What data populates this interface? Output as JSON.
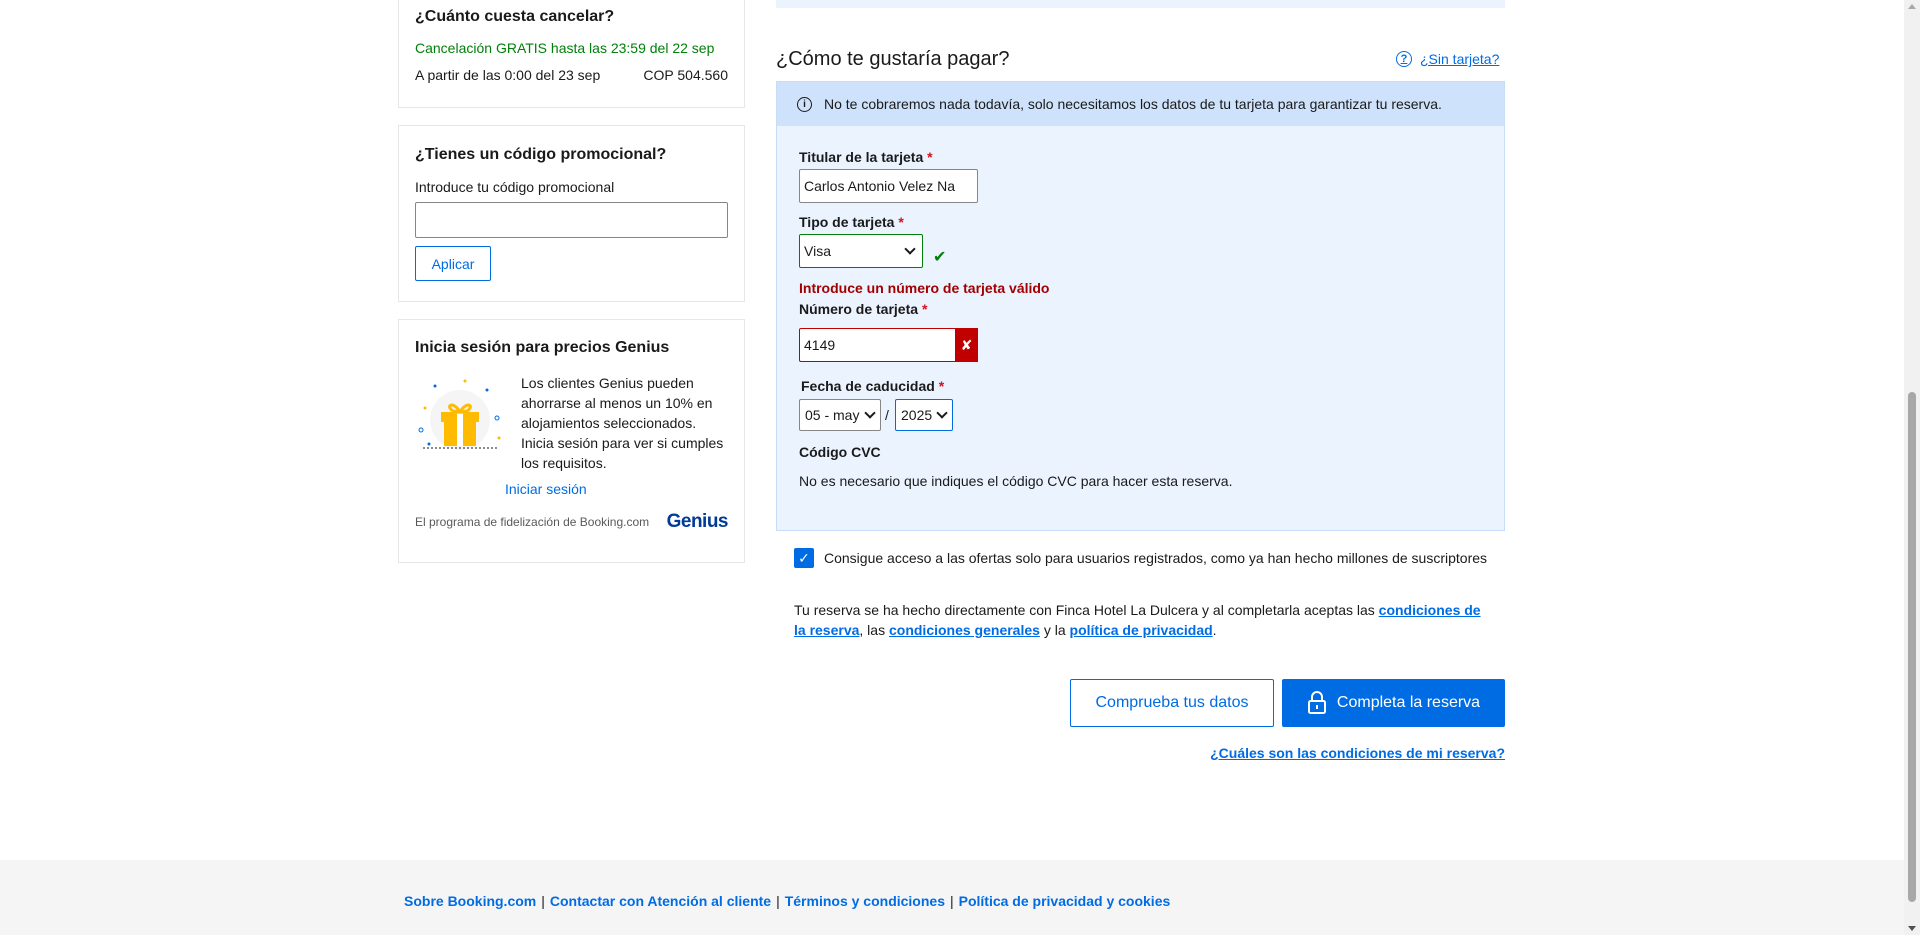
{
  "cancel_card": {
    "title": "¿Cuánto cuesta cancelar?",
    "free_text": "Cancelación GRATIS hasta las 23:59 del 22 sep",
    "from_text": "A partir de las 0:00 del 23 sep",
    "amount": "COP 504.560"
  },
  "promo_card": {
    "title": "¿Tienes un código promocional?",
    "label": "Introduce tu código promocional",
    "input_value": "",
    "apply_label": "Aplicar"
  },
  "genius_card": {
    "title": "Inicia sesión para precios Genius",
    "body": "Los clientes Genius pueden ahorrarse al menos un 10% en alojamientos seleccionados. Inicia sesión para ver si cumples los requisitos.",
    "signin_label": "Iniciar sesión",
    "program_text": "El programa de fidelización de Booking.com",
    "logo_text": "Genius"
  },
  "payment": {
    "title": "¿Cómo te gustaría pagar?",
    "no_card_link": "¿Sin tarjeta?",
    "notice": "No te cobraremos nada todavía, solo necesitamos los datos de tu tarjeta para garantizar tu reserva.",
    "holder_label": "Titular de la tarjeta",
    "holder_value": "Carlos Antonio Velez Na",
    "type_label": "Tipo de tarjeta",
    "type_value": "Visa",
    "error_text": "Introduce un número de tarjeta válido",
    "number_label": "Número de tarjeta",
    "number_value": "4149",
    "expiry_label": "Fecha de caducidad",
    "expiry_month": "05 - may",
    "expiry_year": "2025",
    "cvc_label": "Código CVC",
    "cvc_text": "No es necesario que indiques el código CVC para hacer esta reserva.",
    "required_mark": "*"
  },
  "optin_text": "Consigue acceso a las ofertas solo para usuarios registrados, como ya han hecho millones de suscriptores",
  "terms": {
    "part1": "Tu reserva se ha hecho directamente con Finca Hotel La Dulcera y al completarla aceptas las ",
    "link1": "condiciones de la reserva",
    "part2": ", las ",
    "link2": "condiciones generales",
    "part3": " y la ",
    "link3": "política de privacidad",
    "part4": "."
  },
  "actions": {
    "check_label": "Comprueba tus datos",
    "complete_label": "Completa la reserva",
    "conditions_link": "¿Cuáles son las condiciones de mi reserva?"
  },
  "footer": {
    "links": [
      "Sobre Booking.com",
      "Contactar con Atención al cliente",
      "Términos y condiciones",
      "Política de privacidad y cookies"
    ],
    "separator": "|"
  },
  "colors": {
    "accent": "#006ce4",
    "success": "#008009",
    "error": "#a30000",
    "panel": "#ebf3ff"
  }
}
